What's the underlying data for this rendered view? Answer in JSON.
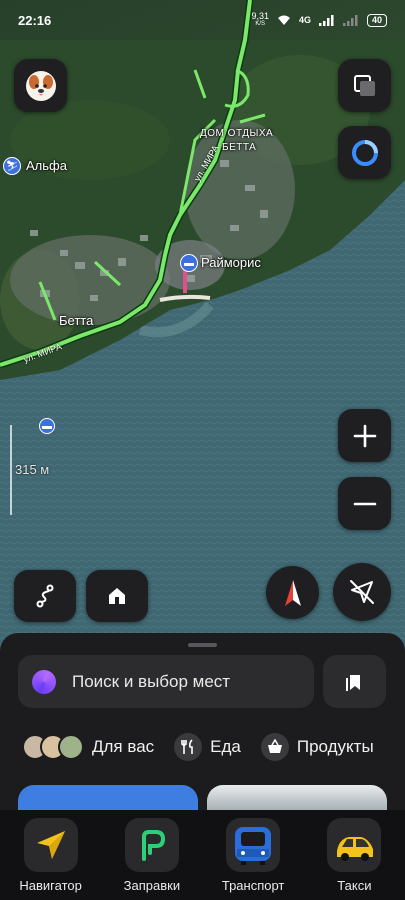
{
  "status_bar": {
    "time": "22:16",
    "speed": "9,31",
    "speed_unit": "K/S",
    "network": "4G",
    "battery": "40"
  },
  "map": {
    "labels": {
      "alfa": "Альфа",
      "dom_otdykha_line1": "ДОМ ОТДЫХА",
      "dom_otdykha_line2": "БЕТТА",
      "raymoris": "Райморис",
      "betta": "Бетта",
      "street_upper": "ул. МИРА",
      "street_lower": "ул. МИРА"
    },
    "scale_label": "315 м"
  },
  "sheet": {
    "search_placeholder": "Поиск и выбор мест",
    "categories": [
      {
        "label": "Для вас",
        "icon": "for-you-avatars"
      },
      {
        "label": "Еда",
        "icon": "fork-knife-icon"
      },
      {
        "label": "Продукты",
        "icon": "basket-icon"
      }
    ]
  },
  "nav": [
    {
      "label": "Навигатор",
      "icon": "navigator-arrow-icon"
    },
    {
      "label": "Заправки",
      "icon": "fuel-p-icon"
    },
    {
      "label": "Транспорт",
      "icon": "bus-icon"
    },
    {
      "label": "Такси",
      "icon": "taxi-car-icon"
    }
  ],
  "colors": {
    "accent_route": "#7be86b",
    "sheet_bg": "#1c1c1e",
    "control_bg": "#1f1f22",
    "alice_purple": "#7b4cf5",
    "card_blue": "#3d7ee0",
    "fuel_green": "#2ecf77",
    "taxi_yellow": "#f5c21b"
  }
}
